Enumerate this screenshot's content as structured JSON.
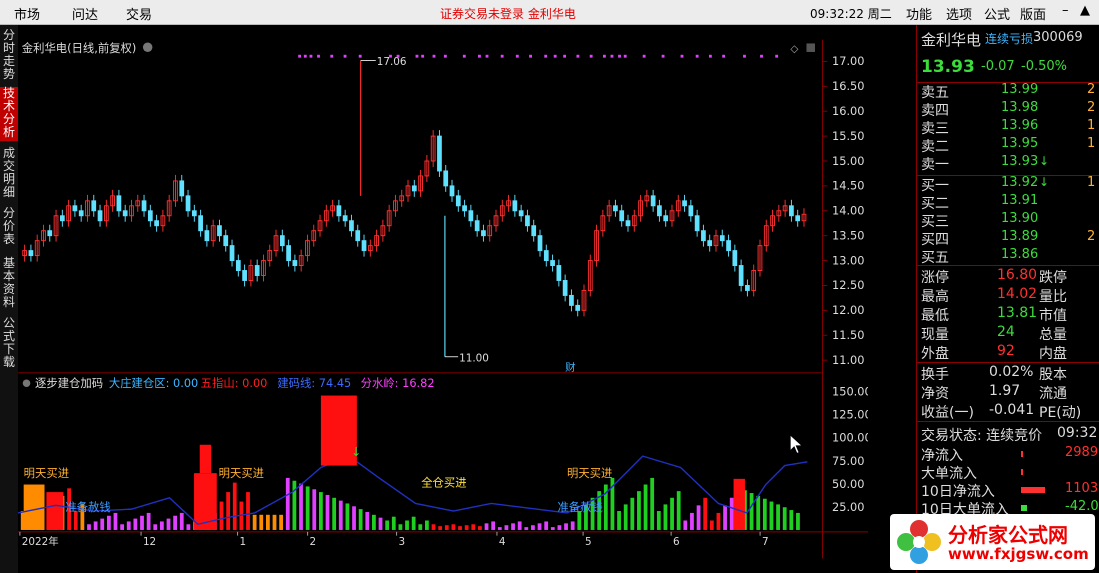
{
  "menu": [
    "市场",
    "问达",
    "交易"
  ],
  "alert": "证券交易未登录  金利华电",
  "clock": "09:32:22 周二",
  "right_menu": [
    "功能",
    "选项",
    "公式",
    "版面"
  ],
  "left_tabs": [
    {
      "label": "分时走势",
      "active": false
    },
    {
      "label": "技术分析",
      "active": true
    },
    {
      "label": "成交明细",
      "active": false
    },
    {
      "label": "分价表",
      "active": false
    },
    {
      "label": "基本资料",
      "active": false
    },
    {
      "label": "公式下载",
      "active": false
    }
  ],
  "main_chart": {
    "title": "金利华电(日线,前复权)",
    "price_labels": [
      "17.00",
      "16.50",
      "16.00",
      "15.50",
      "15.00",
      "14.50",
      "14.00",
      "13.50",
      "13.00",
      "12.50",
      "12.00",
      "11.50",
      "11.00"
    ],
    "high_label": "17.06",
    "low_label": "11.00",
    "fin_marker": "财"
  },
  "indicator": {
    "name": "逐步建仓加码",
    "params": [
      {
        "label": "大庄建仓区: 0.00",
        "color": "#3fb6ff"
      },
      {
        "label": "五指山: 0.00",
        "color": "#ff2020"
      },
      {
        "label": "建码线: 74.45",
        "color": "#3a6bff"
      },
      {
        "label": "分水岭: 16.82",
        "color": "#ff40ff"
      }
    ],
    "scale_labels": [
      "150.00",
      "125.00",
      "100.00",
      "75.00",
      "50.00",
      "25.00"
    ],
    "annotations": [
      "明天买进",
      "准备赦钱",
      "明天买进",
      "全仓买进",
      "明天买进",
      "准备赦钱"
    ]
  },
  "x_axis": [
    "2022年",
    "12",
    "1",
    "2",
    "3",
    "4",
    "5",
    "6",
    "7"
  ],
  "quote": {
    "name": "金利华电",
    "tag": "连续亏损",
    "code": "300069",
    "price": "13.93",
    "change": "-0.07",
    "change_pct": "-0.50%",
    "asks": [
      {
        "label": "卖五",
        "price": "13.99",
        "vol": "2"
      },
      {
        "label": "卖四",
        "price": "13.98",
        "vol": "2"
      },
      {
        "label": "卖三",
        "price": "13.96",
        "vol": "1"
      },
      {
        "label": "卖二",
        "price": "13.95",
        "vol": "1"
      },
      {
        "label": "卖一",
        "price": "13.93",
        "vol": ""
      }
    ],
    "bids": [
      {
        "label": "买一",
        "price": "13.92",
        "vol": "1"
      },
      {
        "label": "买二",
        "price": "13.91",
        "vol": ""
      },
      {
        "label": "买三",
        "price": "13.90",
        "vol": ""
      },
      {
        "label": "买四",
        "price": "13.89",
        "vol": "2"
      },
      {
        "label": "买五",
        "price": "13.86",
        "vol": ""
      }
    ],
    "stats": [
      {
        "l1": "涨停",
        "v1": "16.80",
        "c1": "#ff3030",
        "l2": "跌停"
      },
      {
        "l1": "最高",
        "v1": "14.02",
        "c1": "#ff3030",
        "l2": "量比"
      },
      {
        "l1": "最低",
        "v1": "13.81",
        "c1": "#3ddc3d",
        "l2": "市值"
      },
      {
        "l1": "现量",
        "v1": "24",
        "c1": "#3ddc3d",
        "l2": "总量"
      },
      {
        "l1": "外盘",
        "v1": "92",
        "c1": "#ff3030",
        "l2": "内盘"
      }
    ],
    "stats2": [
      {
        "l1": "换手",
        "v1": "0.02%",
        "l2": "股本"
      },
      {
        "l1": "净资",
        "v1": "1.97",
        "l2": "流通"
      },
      {
        "l1": "收益(一)",
        "v1": "-0.041",
        "l2": "PE(动)"
      }
    ],
    "trade_status": "交易状态: 连续竞价",
    "trade_time": "09:32",
    "flows": [
      {
        "label": "净流入",
        "value": "2989",
        "color": "#ff3030"
      },
      {
        "label": "大单流入",
        "value": "",
        "color": "#ff3030"
      },
      {
        "label": "10日净流入",
        "value": "1103",
        "color": "#ff3030"
      },
      {
        "label": "10日大单流入",
        "value": "-42.0",
        "color": "#3ddc3d"
      }
    ]
  },
  "logo": {
    "title": "分析家公式网",
    "url": "www.fxjgsw.com"
  },
  "colors": {
    "up": "#ff3030",
    "down": "#5fe1ff",
    "accent": "#c00000"
  }
}
